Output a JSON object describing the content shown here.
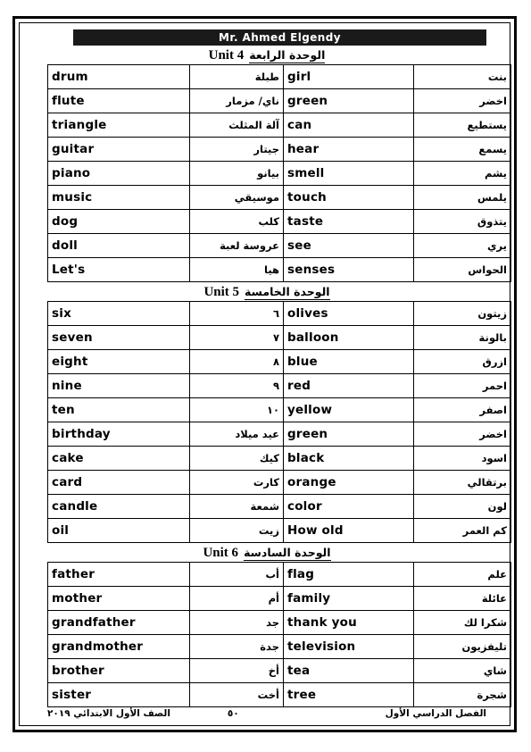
{
  "header": {
    "teacher_name": "Mr. Ahmed Elgendy"
  },
  "sections": [
    {
      "heading_en": "Unit 4",
      "heading_ar": "الوحدة الرابعة",
      "rows": [
        {
          "en1": "drum",
          "ar1": "طبلة",
          "en2": "girl",
          "ar2": "بنت"
        },
        {
          "en1": "flute",
          "ar1": "ناي/ مزمار",
          "en2": "green",
          "ar2": "اخضر"
        },
        {
          "en1": "triangle",
          "ar1": "آلة المثلث",
          "en2": "can",
          "ar2": "يستطيع"
        },
        {
          "en1": "guitar",
          "ar1": "جيتار",
          "en2": "hear",
          "ar2": "يسمع"
        },
        {
          "en1": "piano",
          "ar1": "بيانو",
          "en2": "smell",
          "ar2": "يشم"
        },
        {
          "en1": "music",
          "ar1": "موسيقي",
          "en2": "touch",
          "ar2": "يلمس"
        },
        {
          "en1": "dog",
          "ar1": "كلب",
          "en2": "taste",
          "ar2": "يتذوق"
        },
        {
          "en1": "doll",
          "ar1": "عروسة لعبة",
          "en2": "see",
          "ar2": "يري"
        },
        {
          "en1": "Let's",
          "ar1": "هيا",
          "en2": "senses",
          "ar2": "الحواس"
        }
      ]
    },
    {
      "heading_en": "Unit 5",
      "heading_ar": "الوحدة الخامسة",
      "rows": [
        {
          "en1": "six",
          "ar1": "٦",
          "en2": "olives",
          "ar2": "زيتون"
        },
        {
          "en1": "seven",
          "ar1": "٧",
          "en2": "balloon",
          "ar2": "بالونة"
        },
        {
          "en1": "eight",
          "ar1": "٨",
          "en2": "blue",
          "ar2": "ازرق"
        },
        {
          "en1": "nine",
          "ar1": "٩",
          "en2": "red",
          "ar2": "احمر"
        },
        {
          "en1": "ten",
          "ar1": "١٠",
          "en2": "yellow",
          "ar2": "اصفر"
        },
        {
          "en1": "birthday",
          "ar1": "عيد ميلاد",
          "en2": "green",
          "ar2": "اخضر"
        },
        {
          "en1": "cake",
          "ar1": "كيك",
          "en2": "black",
          "ar2": "اسود"
        },
        {
          "en1": "card",
          "ar1": "كارت",
          "en2": "orange",
          "ar2": "برتقالي"
        },
        {
          "en1": "candle",
          "ar1": "شمعة",
          "en2": "color",
          "ar2": "لون"
        },
        {
          "en1": "oil",
          "ar1": "زيت",
          "en2": "How old",
          "ar2": "كم العمر"
        }
      ]
    },
    {
      "heading_en": "Unit 6",
      "heading_ar": "الوحدة السادسة",
      "rows": [
        {
          "en1": "father",
          "ar1": "أب",
          "en2": "flag",
          "ar2": "علم"
        },
        {
          "en1": "mother",
          "ar1": "أم",
          "en2": "family",
          "ar2": "عائلة"
        },
        {
          "en1": "grandfather",
          "ar1": "جد",
          "en2": "thank you",
          "ar2": "شكرا لك"
        },
        {
          "en1": "grandmother",
          "ar1": "جدة",
          "en2": "television",
          "ar2": "تليفزيون"
        },
        {
          "en1": "brother",
          "ar1": "أخ",
          "en2": "tea",
          "ar2": "شاي"
        },
        {
          "en1": "sister",
          "ar1": "أخت",
          "en2": "tree",
          "ar2": "شجرة"
        }
      ]
    }
  ],
  "footer": {
    "right_text": "الصف الأول الابتدائي ٢٠١٩",
    "page_number": "٥٠",
    "left_text": "الفصل الدراسي الأول"
  }
}
